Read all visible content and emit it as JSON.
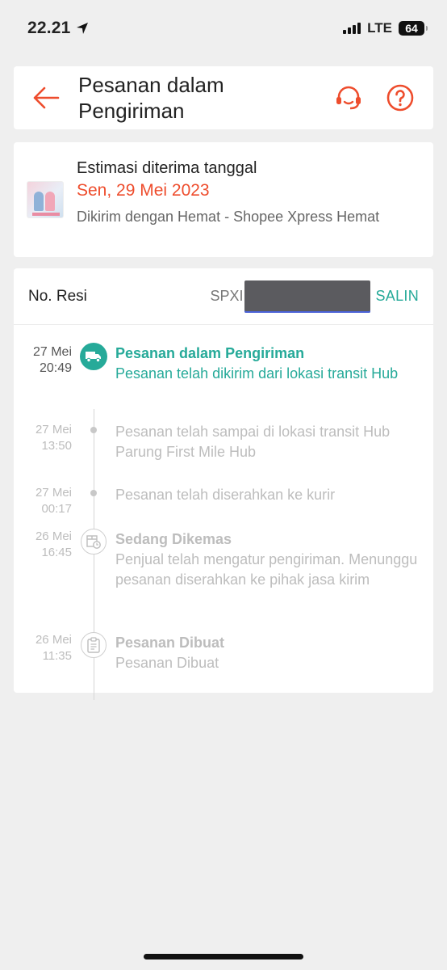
{
  "status_bar": {
    "time": "22.21",
    "network": "LTE",
    "battery": "64"
  },
  "header": {
    "title": "Pesanan dalam Pengiriman",
    "back_icon": "arrow-left-icon",
    "support_icon": "headset-icon",
    "help_icon": "question-circle-icon"
  },
  "estimate": {
    "label": "Estimasi diterima tanggal",
    "date": "Sen, 29 Mei 2023",
    "courier": "Dikirim dengan Hemat - Shopee Xpress Hemat"
  },
  "tracking": {
    "resi_label": "No. Resi",
    "resi_prefix": "SPXI",
    "copy_label": "SALIN",
    "events": [
      {
        "date": "27 Mei",
        "time": "20:49",
        "title": "Pesanan dalam Pengiriman",
        "desc": "Pesanan telah dikirim dari lokasi transit Hub",
        "icon": "truck-icon"
      },
      {
        "date": "27 Mei",
        "time": "13:50",
        "title": "",
        "desc": "Pesanan telah sampai di lokasi transit Hub Parung First Mile Hub",
        "icon": "dot"
      },
      {
        "date": "27 Mei",
        "time": "00:17",
        "title": "",
        "desc": "Pesanan telah diserahkan ke kurir",
        "icon": "dot"
      },
      {
        "date": "26 Mei",
        "time": "16:45",
        "title": "Sedang Dikemas",
        "desc": "Penjual telah mengatur pengiriman. Menunggu pesanan diserahkan ke pihak jasa kirim",
        "icon": "box-clock-icon"
      },
      {
        "date": "26 Mei",
        "time": "11:35",
        "title": "Pesanan Dibuat",
        "desc": "Pesanan Dibuat",
        "icon": "clipboard-icon"
      }
    ]
  },
  "colors": {
    "accent": "#ee4d2d",
    "teal": "#26aa99",
    "muted": "#bdbdbd"
  }
}
